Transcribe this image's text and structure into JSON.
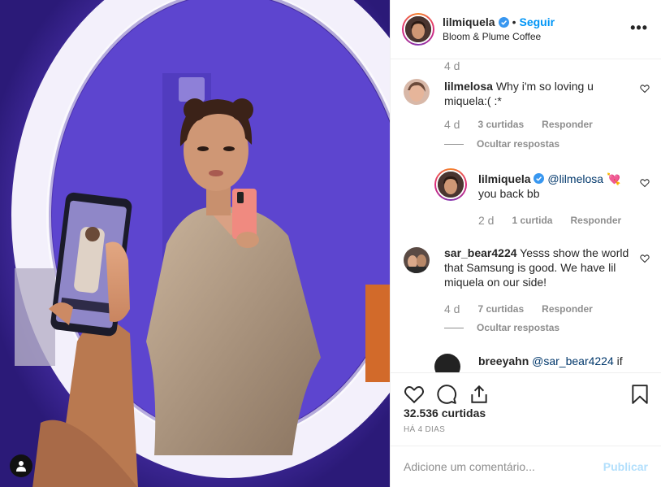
{
  "header": {
    "username": "lilmiquela",
    "separator": "•",
    "follow_label": "Seguir",
    "location": "Bloom & Plume Coffee",
    "more_label": "•••"
  },
  "comments": {
    "top_age": "4 d",
    "items": [
      {
        "user": "lilmelosa",
        "text": "Why i'm so loving u miquela:( :*",
        "age": "4 d",
        "likes": "3 curtidas",
        "reply_label": "Responder",
        "hide_label": "Ocultar respostas"
      },
      {
        "user": "lilmiquela",
        "mention": "@lilmelosa",
        "emoji": "💘",
        "text": "you back bb",
        "age": "2 d",
        "likes": "1 curtida",
        "reply_label": "Responder"
      },
      {
        "user": "sar_bear4224",
        "text": "Yesss show the world that Samsung is good. We have lil miquela on our side!",
        "age": "4 d",
        "likes": "7 curtidas",
        "reply_label": "Responder",
        "hide_label": "Ocultar respostas"
      },
      {
        "user": "breeyahn",
        "mention": "@sar_bear4224",
        "text": "if"
      }
    ]
  },
  "actions": {
    "like_count": "32.536 curtidas",
    "date": "HÁ 4 DIAS"
  },
  "comment_box": {
    "placeholder": "Adicione um comentário...",
    "publish_label": "Publicar"
  },
  "colors": {
    "accent": "#0095f6",
    "publish_disabled": "#b2dffc",
    "muted": "#8e8e8e",
    "mirror_wall": "#5a3dc4"
  }
}
